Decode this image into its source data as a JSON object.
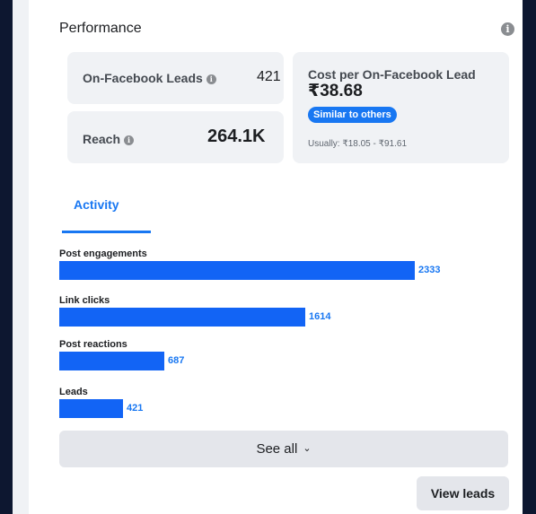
{
  "header": {
    "title": "Performance",
    "info_icon": "info-icon"
  },
  "metrics": {
    "leads": {
      "label": "On-Facebook Leads",
      "value": "421",
      "icon": "info-icon"
    },
    "reach": {
      "label": "Reach",
      "value": "264.1K",
      "icon": "info-icon"
    },
    "cost": {
      "label": "Cost per On-Facebook Lead",
      "value": "₹38.68",
      "badge": "Similar to others",
      "usual_range": "Usually: ₹18.05 - ₹91.61"
    }
  },
  "tabs": [
    {
      "label": "Activity",
      "active": true
    }
  ],
  "activity": {
    "max": 2333,
    "items": [
      {
        "label": "Post engagements",
        "value": 2333
      },
      {
        "label": "Link clicks",
        "value": 1614
      },
      {
        "label": "Post reactions",
        "value": 687
      },
      {
        "label": "Leads",
        "value": 421
      }
    ]
  },
  "buttons": {
    "see_all": "See all",
    "see_all_icon": "chevron-down-icon",
    "view_leads": "View leads"
  },
  "colors": {
    "accent": "#1877f2",
    "bar": "#1264f5",
    "background": "#0d1730"
  }
}
